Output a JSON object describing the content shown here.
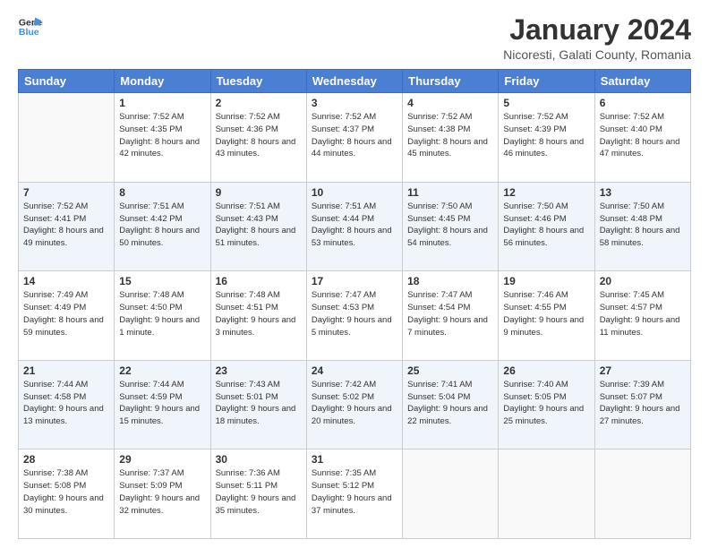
{
  "header": {
    "logo_line1": "General",
    "logo_line2": "Blue",
    "title": "January 2024",
    "subtitle": "Nicoresti, Galati County, Romania"
  },
  "weekdays": [
    "Sunday",
    "Monday",
    "Tuesday",
    "Wednesday",
    "Thursday",
    "Friday",
    "Saturday"
  ],
  "weeks": [
    [
      {
        "day": "",
        "sunrise": "",
        "sunset": "",
        "daylight": ""
      },
      {
        "day": "1",
        "sunrise": "Sunrise: 7:52 AM",
        "sunset": "Sunset: 4:35 PM",
        "daylight": "Daylight: 8 hours and 42 minutes."
      },
      {
        "day": "2",
        "sunrise": "Sunrise: 7:52 AM",
        "sunset": "Sunset: 4:36 PM",
        "daylight": "Daylight: 8 hours and 43 minutes."
      },
      {
        "day": "3",
        "sunrise": "Sunrise: 7:52 AM",
        "sunset": "Sunset: 4:37 PM",
        "daylight": "Daylight: 8 hours and 44 minutes."
      },
      {
        "day": "4",
        "sunrise": "Sunrise: 7:52 AM",
        "sunset": "Sunset: 4:38 PM",
        "daylight": "Daylight: 8 hours and 45 minutes."
      },
      {
        "day": "5",
        "sunrise": "Sunrise: 7:52 AM",
        "sunset": "Sunset: 4:39 PM",
        "daylight": "Daylight: 8 hours and 46 minutes."
      },
      {
        "day": "6",
        "sunrise": "Sunrise: 7:52 AM",
        "sunset": "Sunset: 4:40 PM",
        "daylight": "Daylight: 8 hours and 47 minutes."
      }
    ],
    [
      {
        "day": "7",
        "sunrise": "Sunrise: 7:52 AM",
        "sunset": "Sunset: 4:41 PM",
        "daylight": "Daylight: 8 hours and 49 minutes."
      },
      {
        "day": "8",
        "sunrise": "Sunrise: 7:51 AM",
        "sunset": "Sunset: 4:42 PM",
        "daylight": "Daylight: 8 hours and 50 minutes."
      },
      {
        "day": "9",
        "sunrise": "Sunrise: 7:51 AM",
        "sunset": "Sunset: 4:43 PM",
        "daylight": "Daylight: 8 hours and 51 minutes."
      },
      {
        "day": "10",
        "sunrise": "Sunrise: 7:51 AM",
        "sunset": "Sunset: 4:44 PM",
        "daylight": "Daylight: 8 hours and 53 minutes."
      },
      {
        "day": "11",
        "sunrise": "Sunrise: 7:50 AM",
        "sunset": "Sunset: 4:45 PM",
        "daylight": "Daylight: 8 hours and 54 minutes."
      },
      {
        "day": "12",
        "sunrise": "Sunrise: 7:50 AM",
        "sunset": "Sunset: 4:46 PM",
        "daylight": "Daylight: 8 hours and 56 minutes."
      },
      {
        "day": "13",
        "sunrise": "Sunrise: 7:50 AM",
        "sunset": "Sunset: 4:48 PM",
        "daylight": "Daylight: 8 hours and 58 minutes."
      }
    ],
    [
      {
        "day": "14",
        "sunrise": "Sunrise: 7:49 AM",
        "sunset": "Sunset: 4:49 PM",
        "daylight": "Daylight: 8 hours and 59 minutes."
      },
      {
        "day": "15",
        "sunrise": "Sunrise: 7:48 AM",
        "sunset": "Sunset: 4:50 PM",
        "daylight": "Daylight: 9 hours and 1 minute."
      },
      {
        "day": "16",
        "sunrise": "Sunrise: 7:48 AM",
        "sunset": "Sunset: 4:51 PM",
        "daylight": "Daylight: 9 hours and 3 minutes."
      },
      {
        "day": "17",
        "sunrise": "Sunrise: 7:47 AM",
        "sunset": "Sunset: 4:53 PM",
        "daylight": "Daylight: 9 hours and 5 minutes."
      },
      {
        "day": "18",
        "sunrise": "Sunrise: 7:47 AM",
        "sunset": "Sunset: 4:54 PM",
        "daylight": "Daylight: 9 hours and 7 minutes."
      },
      {
        "day": "19",
        "sunrise": "Sunrise: 7:46 AM",
        "sunset": "Sunset: 4:55 PM",
        "daylight": "Daylight: 9 hours and 9 minutes."
      },
      {
        "day": "20",
        "sunrise": "Sunrise: 7:45 AM",
        "sunset": "Sunset: 4:57 PM",
        "daylight": "Daylight: 9 hours and 11 minutes."
      }
    ],
    [
      {
        "day": "21",
        "sunrise": "Sunrise: 7:44 AM",
        "sunset": "Sunset: 4:58 PM",
        "daylight": "Daylight: 9 hours and 13 minutes."
      },
      {
        "day": "22",
        "sunrise": "Sunrise: 7:44 AM",
        "sunset": "Sunset: 4:59 PM",
        "daylight": "Daylight: 9 hours and 15 minutes."
      },
      {
        "day": "23",
        "sunrise": "Sunrise: 7:43 AM",
        "sunset": "Sunset: 5:01 PM",
        "daylight": "Daylight: 9 hours and 18 minutes."
      },
      {
        "day": "24",
        "sunrise": "Sunrise: 7:42 AM",
        "sunset": "Sunset: 5:02 PM",
        "daylight": "Daylight: 9 hours and 20 minutes."
      },
      {
        "day": "25",
        "sunrise": "Sunrise: 7:41 AM",
        "sunset": "Sunset: 5:04 PM",
        "daylight": "Daylight: 9 hours and 22 minutes."
      },
      {
        "day": "26",
        "sunrise": "Sunrise: 7:40 AM",
        "sunset": "Sunset: 5:05 PM",
        "daylight": "Daylight: 9 hours and 25 minutes."
      },
      {
        "day": "27",
        "sunrise": "Sunrise: 7:39 AM",
        "sunset": "Sunset: 5:07 PM",
        "daylight": "Daylight: 9 hours and 27 minutes."
      }
    ],
    [
      {
        "day": "28",
        "sunrise": "Sunrise: 7:38 AM",
        "sunset": "Sunset: 5:08 PM",
        "daylight": "Daylight: 9 hours and 30 minutes."
      },
      {
        "day": "29",
        "sunrise": "Sunrise: 7:37 AM",
        "sunset": "Sunset: 5:09 PM",
        "daylight": "Daylight: 9 hours and 32 minutes."
      },
      {
        "day": "30",
        "sunrise": "Sunrise: 7:36 AM",
        "sunset": "Sunset: 5:11 PM",
        "daylight": "Daylight: 9 hours and 35 minutes."
      },
      {
        "day": "31",
        "sunrise": "Sunrise: 7:35 AM",
        "sunset": "Sunset: 5:12 PM",
        "daylight": "Daylight: 9 hours and 37 minutes."
      },
      {
        "day": "",
        "sunrise": "",
        "sunset": "",
        "daylight": ""
      },
      {
        "day": "",
        "sunrise": "",
        "sunset": "",
        "daylight": ""
      },
      {
        "day": "",
        "sunrise": "",
        "sunset": "",
        "daylight": ""
      }
    ]
  ]
}
